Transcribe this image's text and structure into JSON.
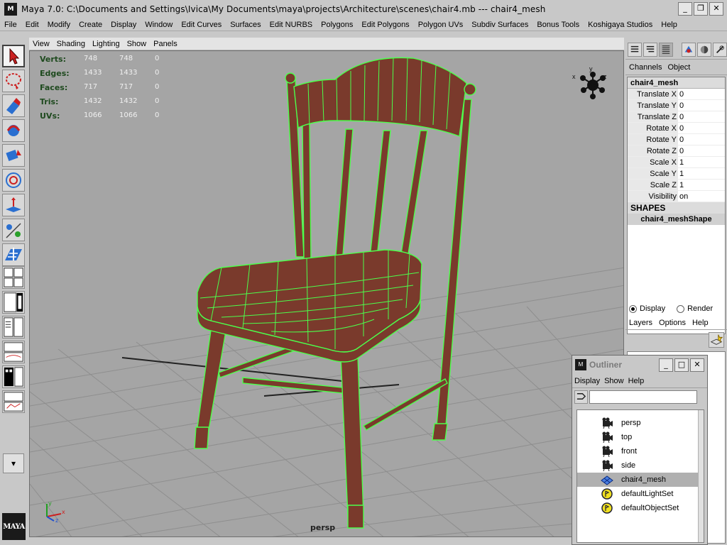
{
  "window": {
    "title": "Maya 7.0: C:\\Documents and Settings\\Ivica\\My Documents\\maya\\projects\\Architecture\\scenes\\chair4.mb   ---   chair4_mesh",
    "app_icon_text": "M",
    "minimize": "_",
    "maximize": "❐",
    "close": "✕"
  },
  "menubar": [
    "File",
    "Edit",
    "Modify",
    "Create",
    "Display",
    "Window",
    "Edit Curves",
    "Surfaces",
    "Edit NURBS",
    "Polygons",
    "Edit Polygons",
    "Polygon UVs",
    "Subdiv Surfaces",
    "Bonus Tools",
    "Koshigaya Studios",
    "Help"
  ],
  "panel_menu": [
    "View",
    "Shading",
    "Lighting",
    "Show",
    "Panels"
  ],
  "hud": [
    {
      "label": "Verts:",
      "v1": "748",
      "v2": "748",
      "v3": "0"
    },
    {
      "label": "Edges:",
      "v1": "1433",
      "v2": "1433",
      "v3": "0"
    },
    {
      "label": "Faces:",
      "v1": "717",
      "v2": "717",
      "v3": "0"
    },
    {
      "label": "Tris:",
      "v1": "1432",
      "v2": "1432",
      "v3": "0"
    },
    {
      "label": "UVs:",
      "v1": "1066",
      "v2": "1066",
      "v3": "0"
    }
  ],
  "viewport": {
    "camera_label": "persp",
    "cube_axes": {
      "x": "x",
      "y": "y",
      "z": "z"
    }
  },
  "toolbox": {
    "logo_text": "MAYA",
    "dropdown": "▾"
  },
  "channel_box": {
    "tabs": [
      "Channels",
      "Object"
    ],
    "object_name": "chair4_mesh",
    "attributes": [
      {
        "name": "Translate X",
        "value": "0"
      },
      {
        "name": "Translate Y",
        "value": "0"
      },
      {
        "name": "Translate Z",
        "value": "0"
      },
      {
        "name": "Rotate X",
        "value": "0"
      },
      {
        "name": "Rotate Y",
        "value": "0"
      },
      {
        "name": "Rotate Z",
        "value": "0"
      },
      {
        "name": "Scale X",
        "value": "1"
      },
      {
        "name": "Scale Y",
        "value": "1"
      },
      {
        "name": "Scale Z",
        "value": "1"
      },
      {
        "name": "Visibility",
        "value": "on"
      }
    ],
    "shapes_header": "SHAPES",
    "shape_name": "chair4_meshShape"
  },
  "layer_editor": {
    "radio_display": "Display",
    "radio_render": "Render",
    "menu": [
      "Layers",
      "Options",
      "Help"
    ]
  },
  "outliner": {
    "title": "Outliner",
    "menu": [
      "Display",
      "Show",
      "Help"
    ],
    "items": [
      {
        "label": "persp",
        "icon": "camera-icon",
        "selected": false
      },
      {
        "label": "top",
        "icon": "camera-icon",
        "selected": false
      },
      {
        "label": "front",
        "icon": "camera-icon",
        "selected": false
      },
      {
        "label": "side",
        "icon": "camera-icon",
        "selected": false
      },
      {
        "label": "chair4_mesh",
        "icon": "mesh-icon",
        "selected": true
      },
      {
        "label": "defaultLightSet",
        "icon": "set-icon",
        "selected": false
      },
      {
        "label": "defaultObjectSet",
        "icon": "set-icon",
        "selected": false
      }
    ]
  },
  "colors": {
    "viewport_bg": "#a5a5a5",
    "wood": "#7a3a2c",
    "wireframe": "#4cff4c",
    "grid": "#8a8a8a"
  }
}
